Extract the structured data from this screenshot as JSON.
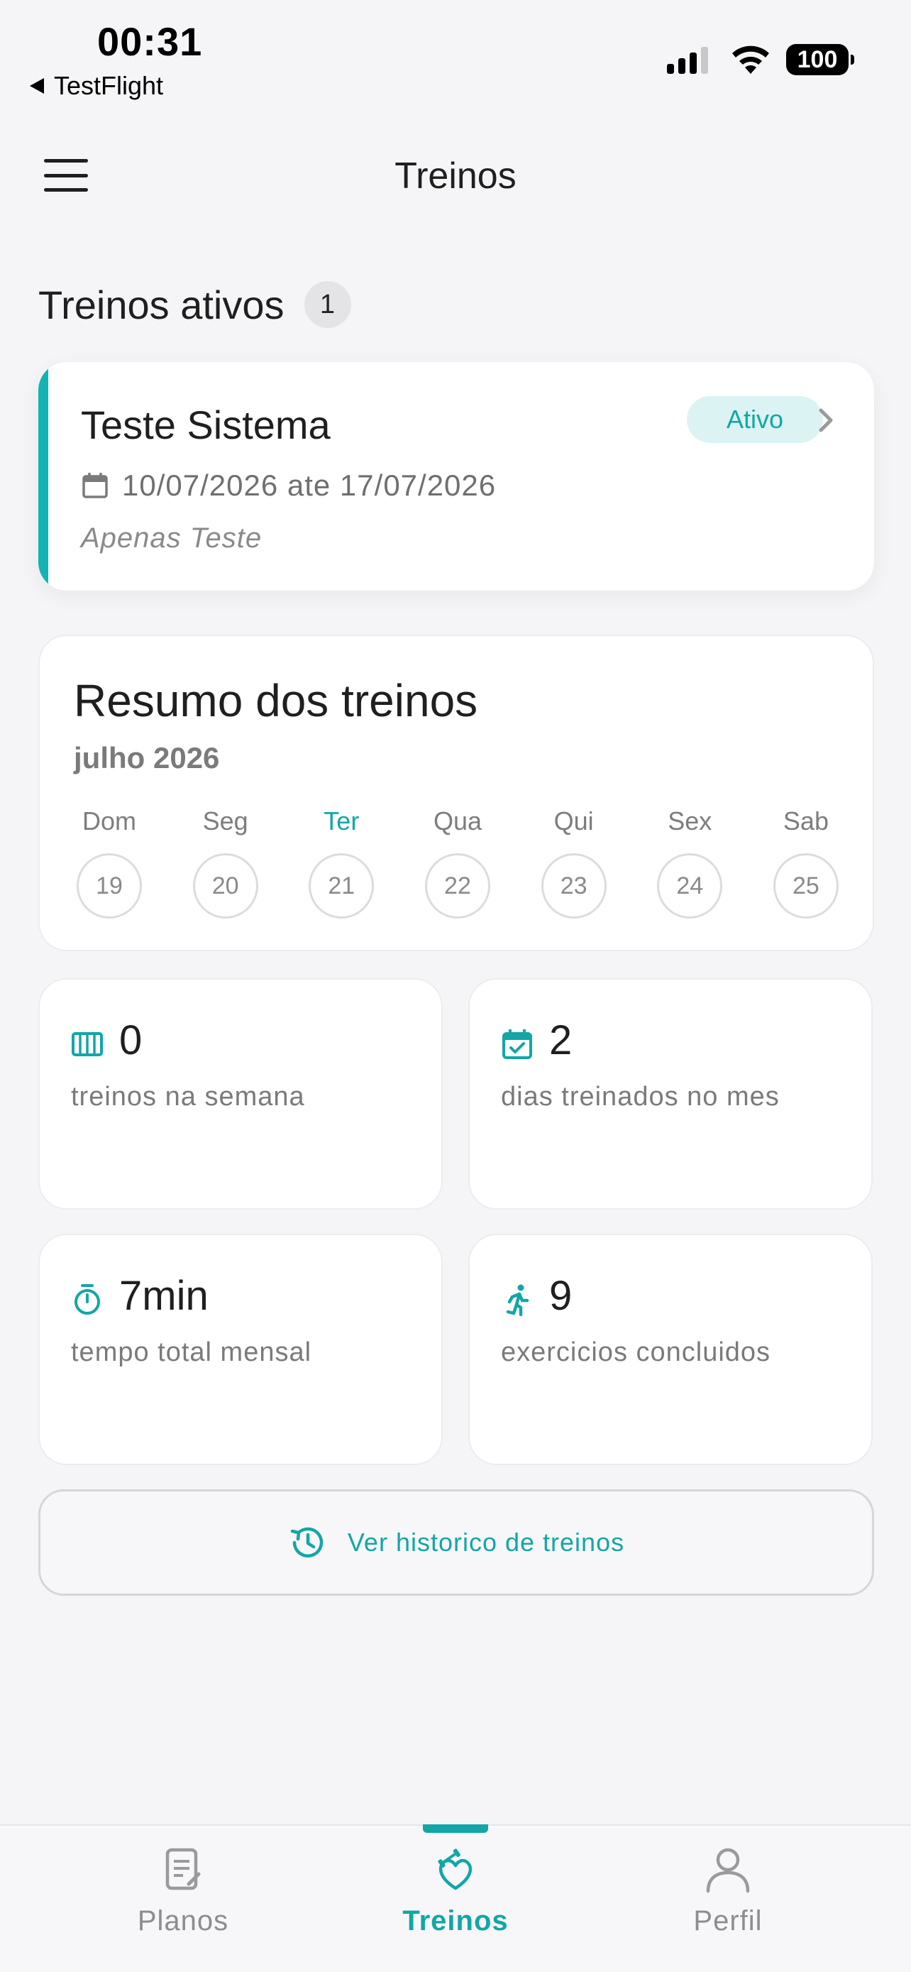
{
  "status_bar": {
    "time": "00:31",
    "back_app": "TestFlight",
    "battery": "100"
  },
  "header": {
    "title": "Treinos",
    "menu_icon": "hamburger-menu-icon"
  },
  "active_section": {
    "title": "Treinos ativos",
    "count": "1"
  },
  "active_plan": {
    "name": "Teste Sistema",
    "status": "Ativo",
    "dates": "10/07/2026 ate 17/07/2026",
    "description": "Apenas Teste",
    "accent_color": "#12b3b3"
  },
  "summary": {
    "title": "Resumo dos treinos",
    "month": "julho 2026",
    "days": [
      {
        "name": "Dom",
        "number": "19"
      },
      {
        "name": "Seg",
        "number": "20"
      },
      {
        "name": "Ter",
        "number": "21"
      },
      {
        "name": "Qua",
        "number": "22"
      },
      {
        "name": "Qui",
        "number": "23"
      },
      {
        "name": "Sex",
        "number": "24"
      },
      {
        "name": "Sab",
        "number": "25"
      }
    ]
  },
  "stats": [
    {
      "icon": "week-columns-icon",
      "value": "0",
      "label": "treinos na semana"
    },
    {
      "icon": "calendar-check-icon",
      "value": "2",
      "label": "dias treinados no mes"
    },
    {
      "icon": "stopwatch-icon",
      "value": "7min",
      "label": "tempo total mensal"
    },
    {
      "icon": "running-person-icon",
      "value": "9",
      "label": "exercicios concluidos"
    }
  ],
  "history_button": {
    "label": "Ver historico de treinos",
    "icon": "history-icon"
  },
  "bottom_nav": {
    "items": [
      {
        "label": "Planos",
        "icon": "clipboard-icon"
      },
      {
        "label": "Treinos",
        "icon": "heart-dumbbell-icon"
      },
      {
        "label": "Perfil",
        "icon": "person-icon"
      }
    ]
  },
  "colors": {
    "accent": "#13a6a6",
    "background": "#f5f5f7"
  }
}
